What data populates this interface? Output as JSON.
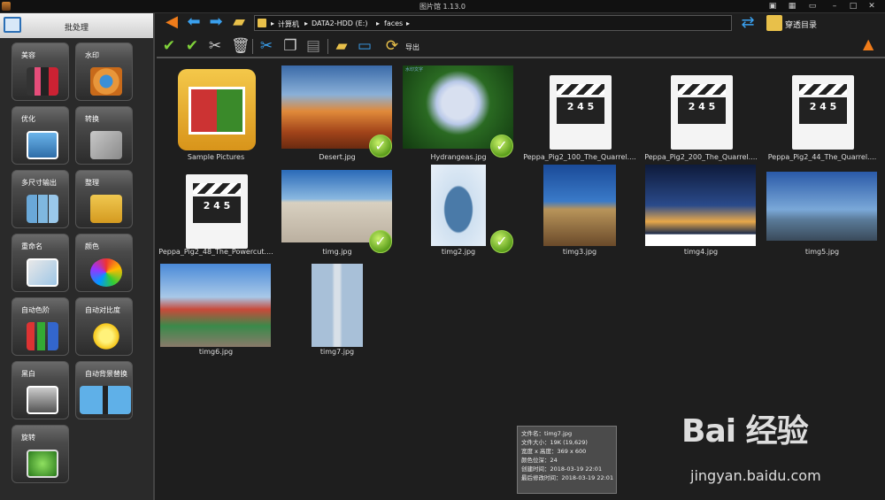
{
  "window": {
    "title": "图片馆 1.13.0"
  },
  "sidebar": {
    "header": "批处理",
    "tools": [
      {
        "label": "美容"
      },
      {
        "label": "水印"
      },
      {
        "label": "优化"
      },
      {
        "label": "转换"
      },
      {
        "label": "多尺寸输出"
      },
      {
        "label": "整理"
      },
      {
        "label": "重命名"
      },
      {
        "label": "颜色"
      },
      {
        "label": "自动色阶"
      },
      {
        "label": "自动对比度"
      },
      {
        "label": "黑白"
      },
      {
        "label": "自动背景替换"
      },
      {
        "label": "旋转"
      }
    ]
  },
  "address": {
    "crumbs": [
      "计算机",
      "DATA2-HDD (E:)",
      "faces"
    ]
  },
  "tree_toggle": {
    "label": "穿透目录"
  },
  "toolbar": {
    "export_label": "导出"
  },
  "files": [
    {
      "name": "Sample Pictures",
      "kind": "folder",
      "checked": false
    },
    {
      "name": "Desert.jpg",
      "kind": "image",
      "checked": true
    },
    {
      "name": "Hydrangeas.jpg",
      "kind": "image",
      "checked": true,
      "overlay_text": "水印文字"
    },
    {
      "name": "Peppa_Pig2_100_The_Quarrel....",
      "kind": "video",
      "checked": false
    },
    {
      "name": "Peppa_Pig2_200_The_Quarrel....",
      "kind": "video",
      "checked": false
    },
    {
      "name": "Peppa_Pig2_44_The_Quarrel....",
      "kind": "video",
      "checked": false
    },
    {
      "name": "Peppa_Pig2_48_The_Powercut....",
      "kind": "video",
      "checked": false
    },
    {
      "name": "timg.jpg",
      "kind": "image",
      "checked": true
    },
    {
      "name": "timg2.jpg",
      "kind": "image",
      "checked": true
    },
    {
      "name": "timg3.jpg",
      "kind": "image",
      "checked": false
    },
    {
      "name": "timg4.jpg",
      "kind": "image",
      "checked": false
    },
    {
      "name": "timg5.jpg",
      "kind": "image",
      "checked": false
    },
    {
      "name": "timg6.jpg",
      "kind": "image",
      "checked": false
    },
    {
      "name": "timg7.jpg",
      "kind": "image",
      "checked": false
    }
  ],
  "clapper_numbers": "2 4 5",
  "tooltip": {
    "lines": [
      "文件名：timg7.jpg",
      "文件大小：19K (19,629)",
      "宽度 x 高度：369 x 600",
      "颜色位深：24",
      "创建时间：2018-03-19 22:01",
      "最后修改时间：2018-03-19 22:01"
    ]
  },
  "watermark": {
    "logo": "Bai 经验",
    "url": "jingyan.baidu.com"
  }
}
